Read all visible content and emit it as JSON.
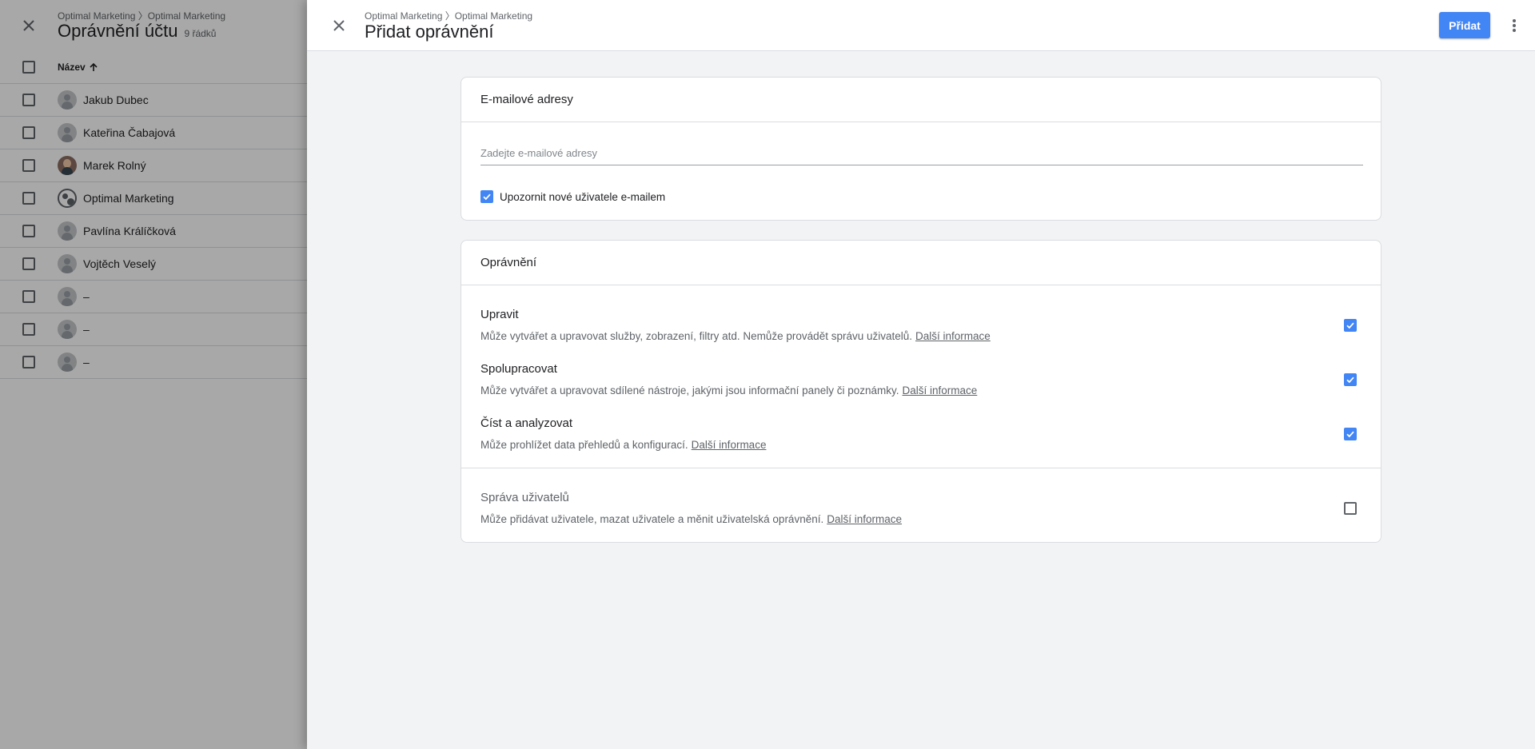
{
  "background": {
    "breadcrumb": "Optimal Marketing 〉Optimal Marketing",
    "title": "Oprávnění účtu",
    "row_count": "9 řádků",
    "column_header": "Název",
    "users": [
      "Jakub Dubec",
      "Kateřina Čabajová",
      "Marek Rolný",
      "Optimal Marketing",
      "Pavlína Králíčková",
      "Vojtěch Veselý",
      "–",
      "–",
      "–"
    ]
  },
  "dialog": {
    "breadcrumb": "Optimal Marketing 〉Optimal Marketing",
    "title": "Přidat oprávnění",
    "add_button": "Přidat",
    "email_section": {
      "title": "E-mailové adresy",
      "input_placeholder": "Zadejte e-mailové adresy",
      "input_value": "",
      "notify_label": "Upozornit nové uživatele e-mailem",
      "notify_checked": true
    },
    "permissions_section": {
      "title": "Oprávnění",
      "items": [
        {
          "title": "Upravit",
          "description": "Může vytvářet a upravovat služby, zobrazení, filtry atd. Nemůže provádět správu uživatelů.",
          "link": "Další informace",
          "checked": true
        },
        {
          "title": "Spolupracovat",
          "description": "Může vytvářet a upravovat sdílené nástroje, jakými jsou informační panely či poznámky.",
          "link": "Další informace",
          "checked": true
        },
        {
          "title": "Číst a analyzovat",
          "description": "Může prohlížet data přehledů a konfigurací.",
          "link": "Další informace",
          "checked": true
        },
        {
          "title": "Správa uživatelů",
          "description": "Může přidávat uživatele, mazat uživatele a měnit uživatelská oprávnění.",
          "link": "Další informace",
          "checked": false
        }
      ]
    }
  },
  "colors": {
    "primary": "#4285f4",
    "text": "#202124",
    "secondary_text": "#5f6368",
    "divider": "#dadce0",
    "dialog_background": "#f1f3f4"
  }
}
